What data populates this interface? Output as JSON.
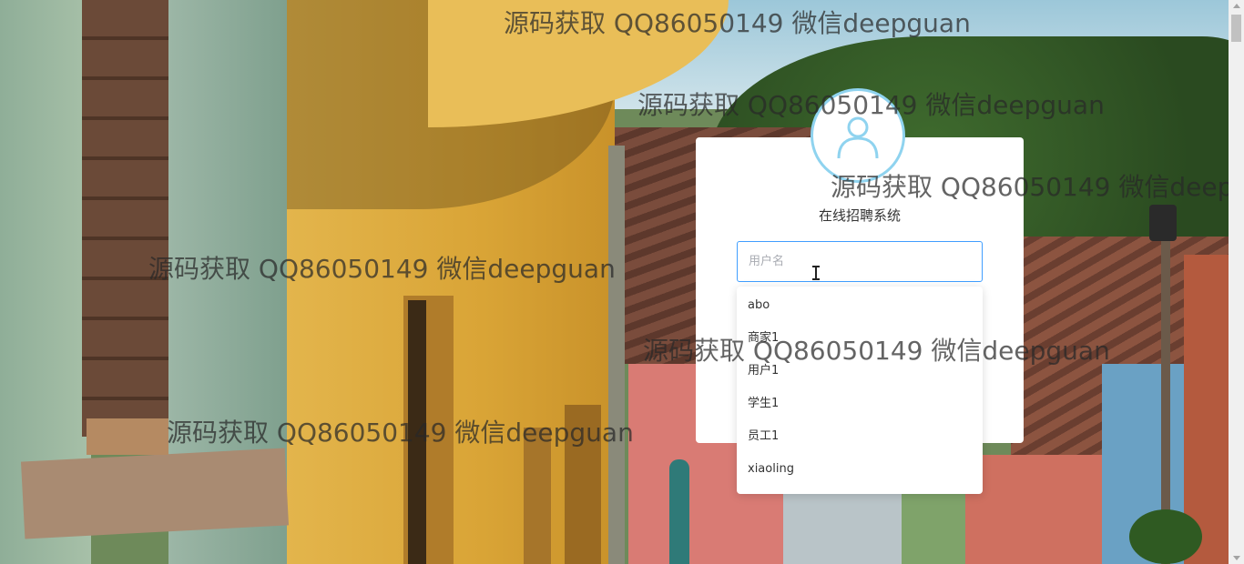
{
  "login": {
    "system_title": "在线招聘系统",
    "username_placeholder": "用户名"
  },
  "username_suggestions": [
    "abo",
    "商家1",
    "用户1",
    "学生1",
    "员工1",
    "xiaoling"
  ],
  "watermark": "源码获取 QQ86050149 微信deepguan",
  "colors": {
    "input_focus_border": "#409eff",
    "avatar_ring": "#8fd3ef",
    "card_background": "#ffffff"
  },
  "icons": {
    "avatar": "user-avatar-icon",
    "text_cursor": "text-cursor-icon"
  }
}
